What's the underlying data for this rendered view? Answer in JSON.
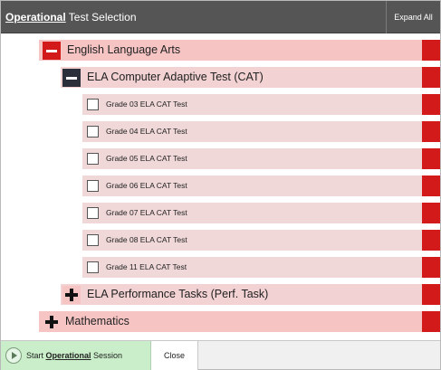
{
  "header": {
    "title_bold": "Operational",
    "title_rest": " Test Selection",
    "expand_all_label": "Expand All"
  },
  "colors": {
    "header_bg": "#555555",
    "subject_bg": "#f7c4c4",
    "accent_red": "#d21a1a",
    "start_bg": "#c9eec9"
  },
  "tree": {
    "subjects": [
      {
        "label": "English Language Arts",
        "expanded": true,
        "groups": [
          {
            "label": "ELA Computer Adaptive Test (CAT)",
            "expanded": true,
            "tests": [
              {
                "label": "Grade 03 ELA CAT Test",
                "checked": false
              },
              {
                "label": "Grade 04 ELA CAT Test",
                "checked": false
              },
              {
                "label": "Grade 05 ELA CAT Test",
                "checked": false
              },
              {
                "label": "Grade 06 ELA CAT Test",
                "checked": false
              },
              {
                "label": "Grade 07 ELA CAT Test",
                "checked": false
              },
              {
                "label": "Grade 08 ELA CAT Test",
                "checked": false
              },
              {
                "label": "Grade 11 ELA CAT Test",
                "checked": false
              }
            ]
          },
          {
            "label": "ELA Performance Tasks (Perf. Task)",
            "expanded": false
          }
        ]
      },
      {
        "label": "Mathematics",
        "expanded": false
      }
    ]
  },
  "footer": {
    "start_prefix": "Start ",
    "start_bold": "Operational",
    "start_suffix": " Session",
    "close_label": "Close"
  }
}
